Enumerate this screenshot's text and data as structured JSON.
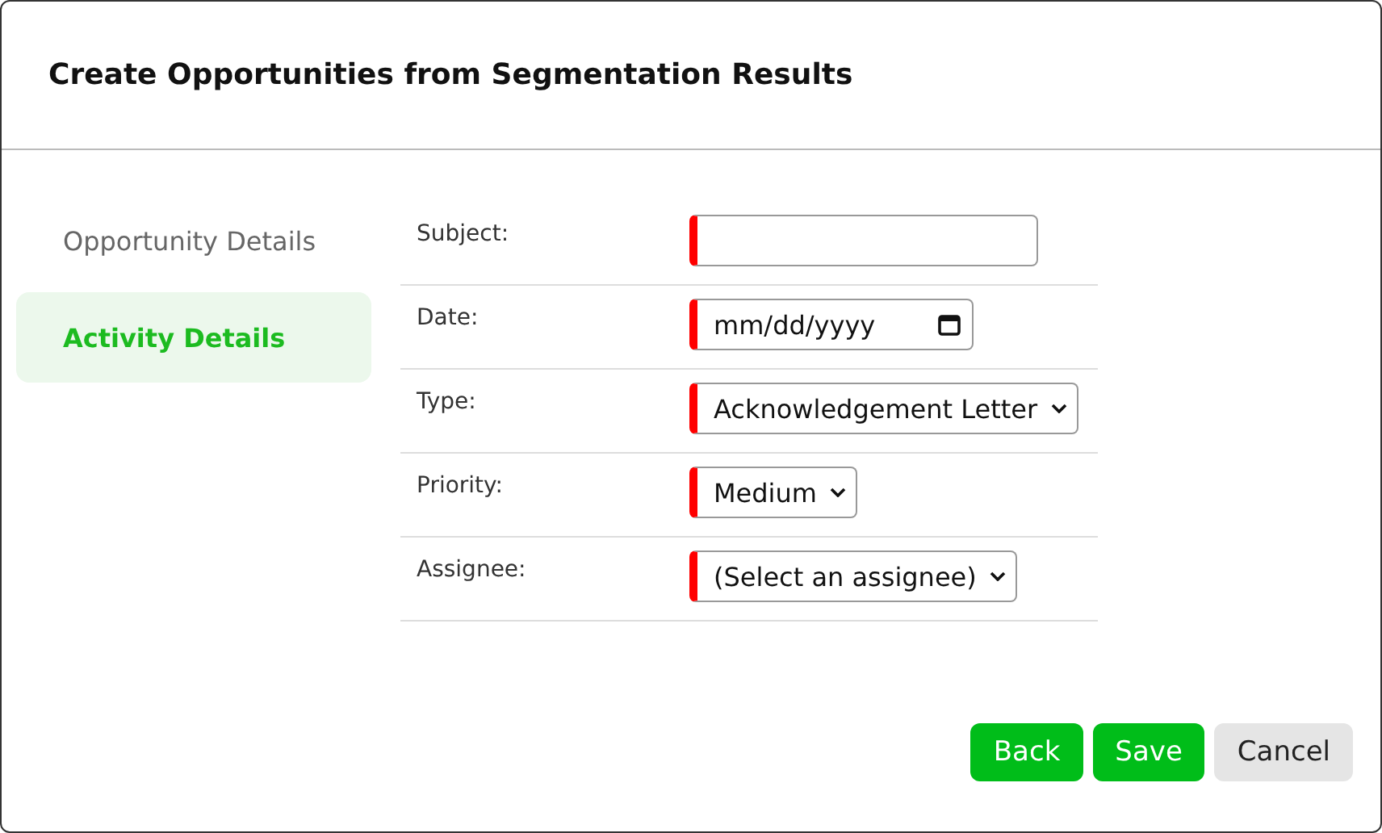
{
  "dialog": {
    "title": "Create Opportunities from Segmentation Results"
  },
  "tabs": [
    {
      "label": "Opportunity Details",
      "selected": false
    },
    {
      "label": "Activity Details",
      "selected": true
    }
  ],
  "fields": [
    {
      "label": "Subject:",
      "kind": "text",
      "required": true
    },
    {
      "label": "Date:",
      "kind": "date",
      "required": true,
      "placeholder": "mm/dd/yyyy"
    },
    {
      "label": "Type:",
      "kind": "select",
      "required": true,
      "value": "Acknowledgement Letter"
    },
    {
      "label": "Priority:",
      "kind": "select",
      "required": true,
      "value": "Medium"
    },
    {
      "label": "Assignee:",
      "kind": "select",
      "required": true,
      "value": "(Select an assignee)"
    }
  ],
  "buttons": [
    {
      "label": "Back",
      "kind": "primary"
    },
    {
      "label": "Save",
      "kind": "primary"
    },
    {
      "label": "Cancel",
      "kind": "secondary"
    }
  ]
}
